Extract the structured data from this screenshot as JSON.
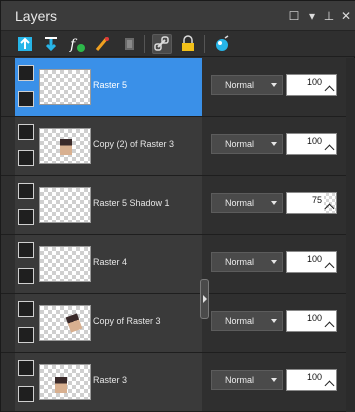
{
  "panel": {
    "title": "Layers",
    "window_buttons": [
      "maximize-icon",
      "menu-dropdown-icon",
      "pin-icon",
      "close-icon"
    ],
    "window_button_glyphs": [
      "☐",
      "▾",
      "⊥",
      "✕"
    ]
  },
  "toolbar": {
    "tools": [
      {
        "name": "new-raster-layer-icon",
        "selected": false
      },
      {
        "name": "new-vector-layer-icon",
        "selected": false
      },
      {
        "name": "new-adjustment-layer-icon",
        "selected": false
      },
      {
        "name": "new-mask-layer-icon",
        "selected": false
      },
      {
        "name": "delete-layer-icon",
        "selected": false
      },
      {
        "name": "link-layers-icon",
        "selected": true
      },
      {
        "name": "lock-transparency-icon",
        "selected": false
      },
      {
        "name": "layer-properties-icon",
        "selected": false
      }
    ]
  },
  "layers": [
    {
      "name": "Raster 5",
      "blend_mode": "Normal",
      "opacity": 100,
      "selected": true,
      "thumb": "empty"
    },
    {
      "name": "Copy (2) of Raster 3",
      "blend_mode": "Normal",
      "opacity": 100,
      "selected": false,
      "thumb": "figure"
    },
    {
      "name": "Raster 5 Shadow 1",
      "blend_mode": "Normal",
      "opacity": 75,
      "selected": false,
      "thumb": "empty"
    },
    {
      "name": "Raster 4",
      "blend_mode": "Normal",
      "opacity": 100,
      "selected": false,
      "thumb": "empty"
    },
    {
      "name": "Copy of Raster 3",
      "blend_mode": "Normal",
      "opacity": 100,
      "selected": false,
      "thumb": "figure"
    },
    {
      "name": "Raster 3",
      "blend_mode": "Normal",
      "opacity": 100,
      "selected": false,
      "thumb": "figure"
    }
  ],
  "colors": {
    "selection": "#3a90e8",
    "panel_bg": "#2f2f2f",
    "row_bg": "#3a3a3a",
    "accent_tool": "#27b5e8"
  }
}
